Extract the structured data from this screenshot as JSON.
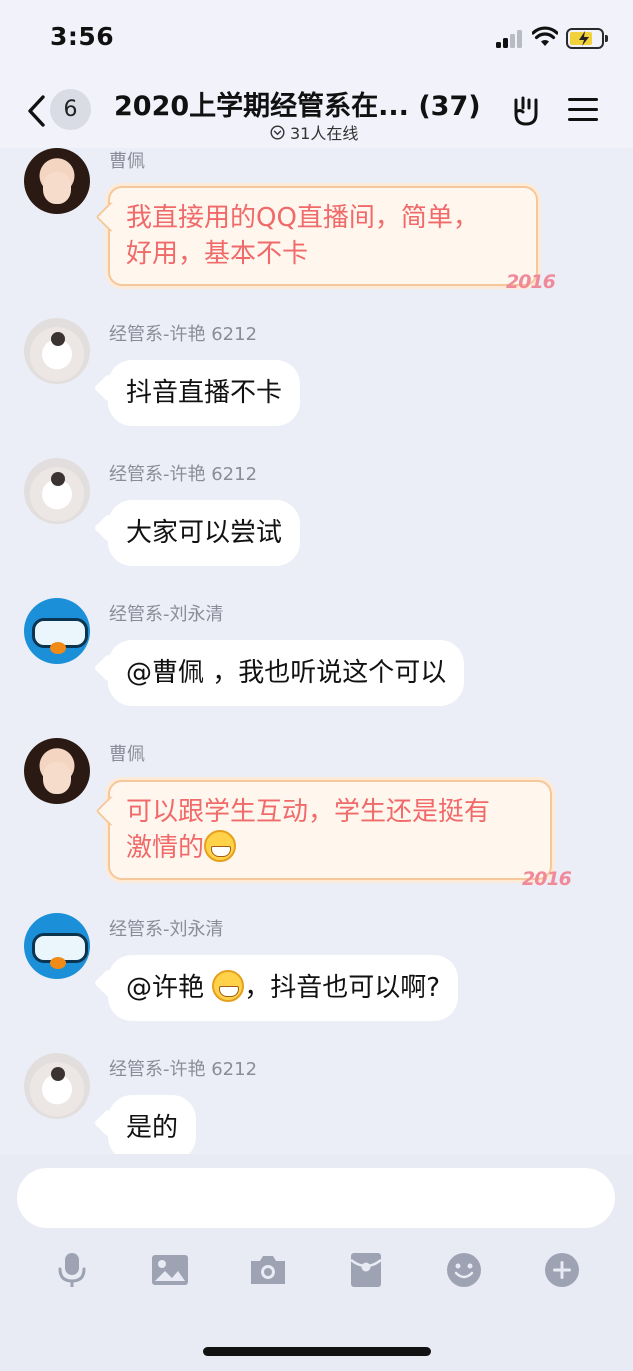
{
  "status_bar": {
    "time": "3:56"
  },
  "nav": {
    "unread_count": "6",
    "title": "2020上学期经管系在... (37)",
    "online_text": "31人在线"
  },
  "messages": [
    {
      "sender": "曹佩",
      "text_lines": [
        "我直接用的QQ直播间，简单，",
        "好用，基本不卡"
      ],
      "style": "fancy",
      "avatar": "woman"
    },
    {
      "sender": "经管系-许艳 6212",
      "text": "抖音直播不卡",
      "style": "plain",
      "avatar": "photo"
    },
    {
      "sender": "经管系-许艳 6212",
      "text": "大家可以尝试",
      "style": "plain",
      "avatar": "photo"
    },
    {
      "sender": "经管系-刘永清",
      "text": "@曹佩 ，我也听说这个可以",
      "style": "plain",
      "avatar": "penguin"
    },
    {
      "sender": "曹佩",
      "text_lines": [
        "可以跟学生互动，学生还是挺有",
        "激情的"
      ],
      "style": "fancy",
      "avatar": "woman"
    },
    {
      "sender": "经管系-刘永清",
      "text_before": "@许艳 ",
      "text_after": "，抖音也可以啊?",
      "style": "plain",
      "avatar": "penguin"
    },
    {
      "sender": "经管系-许艳 6212",
      "text": "是的",
      "style": "plain",
      "avatar": "photo"
    }
  ],
  "bubble_decoration": "2016",
  "composer": {
    "input_value": "",
    "tools": [
      "microphone-icon",
      "image-icon",
      "camera-icon",
      "red-packet-icon",
      "emoji-icon",
      "plus-icon"
    ]
  },
  "colors": {
    "fancy_text": "#f06a6a",
    "background": "#eceef7",
    "sender_text": "#8a8d99"
  }
}
